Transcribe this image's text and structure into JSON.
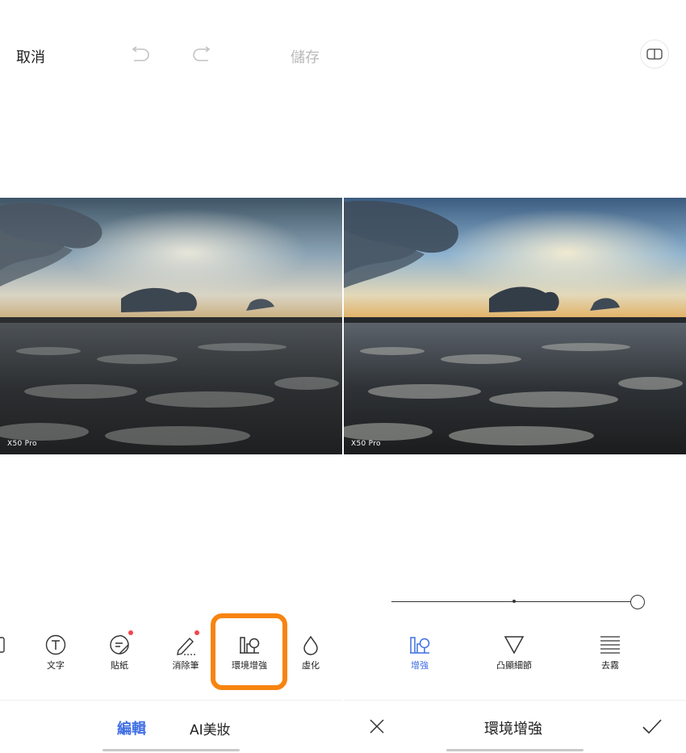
{
  "left": {
    "topbar": {
      "cancel": "取消",
      "save": "儲存"
    },
    "watermark": "X50 Pro",
    "tools": [
      {
        "label": "文字",
        "icon": "text-icon"
      },
      {
        "label": "貼紙",
        "icon": "sticker-icon"
      },
      {
        "label": "消除筆",
        "icon": "eraser-pen-icon"
      },
      {
        "label": "環境增強",
        "icon": "scene-enhance-icon"
      },
      {
        "label": "虛化",
        "icon": "blur-drop-icon"
      }
    ],
    "tabs": {
      "edit": "編輯",
      "ai_makeup": "AI美妝"
    }
  },
  "right": {
    "watermark": "X50 Pro",
    "slider": {
      "value": 1.0
    },
    "options": [
      {
        "label": "增強",
        "icon": "scene-enhance-icon"
      },
      {
        "label": "凸顯細節",
        "icon": "triangle-detail-icon"
      },
      {
        "label": "去霧",
        "icon": "dehaze-icon"
      }
    ],
    "bottom_title": "環境增強"
  },
  "colors": {
    "accent": "#3f6ee4",
    "highlight": "#f7840f",
    "badge": "#f0474f"
  }
}
